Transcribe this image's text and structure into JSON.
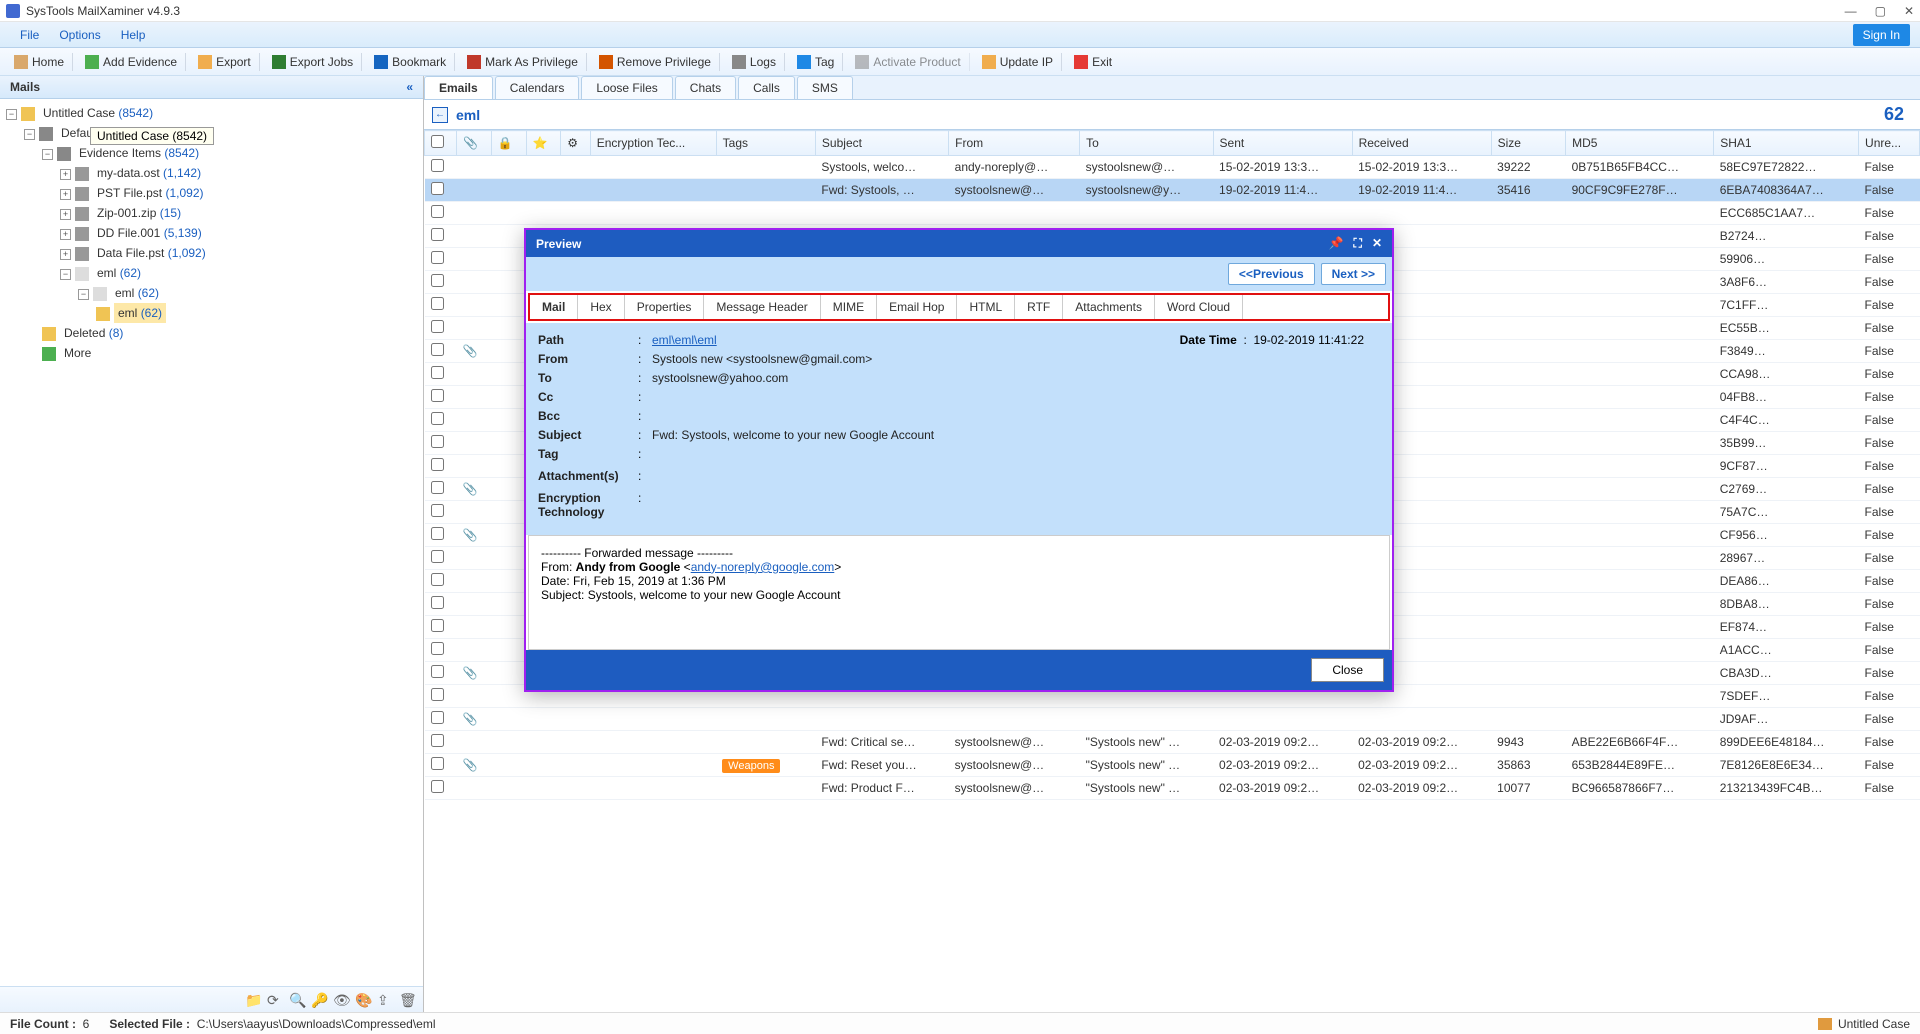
{
  "app": {
    "title": "SysTools MailXaminer v4.9.3"
  },
  "window_buttons": {
    "min": "—",
    "max": "▢",
    "close": "✕"
  },
  "menu": {
    "file": "File",
    "options": "Options",
    "help": "Help",
    "signin": "Sign In"
  },
  "toolbar": {
    "home": "Home",
    "add_evidence": "Add Evidence",
    "export": "Export",
    "export_jobs": "Export Jobs",
    "bookmark": "Bookmark",
    "mark_priv": "Mark As Privilege",
    "remove_priv": "Remove Privilege",
    "logs": "Logs",
    "tag": "Tag",
    "activate": "Activate Product",
    "update_ip": "Update IP",
    "exit": "Exit"
  },
  "mails_panel": {
    "title": "Mails",
    "tooltip": "Untitled Case (8542)",
    "tree": {
      "root": {
        "label": "Untitled Case",
        "count": "(8542)"
      },
      "default": {
        "label": "Default",
        "count": "(8542)"
      },
      "evidence": {
        "label": "Evidence Items",
        "count": "(8542)"
      },
      "items": [
        {
          "label": "my-data.ost",
          "count": "(1,142)"
        },
        {
          "label": "PST File.pst",
          "count": "(1,092)"
        },
        {
          "label": "Zip-001.zip",
          "count": "(15)"
        },
        {
          "label": "DD File.001",
          "count": "(5,139)"
        },
        {
          "label": "Data File.pst",
          "count": "(1,092)"
        },
        {
          "label": "eml",
          "count": "(62)"
        }
      ],
      "eml_sub1": {
        "label": "eml",
        "count": "(62)"
      },
      "eml_sub2": {
        "label": "eml",
        "count": "(62)"
      },
      "deleted": {
        "label": "Deleted",
        "count": "(8)"
      },
      "more": {
        "label": "More"
      }
    }
  },
  "tabs": {
    "emails": "Emails",
    "calendars": "Calendars",
    "loose": "Loose Files",
    "chats": "Chats",
    "calls": "Calls",
    "sms": "SMS"
  },
  "breadcrumb": {
    "path": "eml",
    "count": "62"
  },
  "columns": {
    "enc": "Encryption Tec...",
    "tags": "Tags",
    "subject": "Subject",
    "from": "From",
    "to": "To",
    "sent": "Sent",
    "received": "Received",
    "size": "Size",
    "md5": "MD5",
    "sha1": "SHA1",
    "unre": "Unre..."
  },
  "rows": [
    {
      "tags": "",
      "subject": "Systools, welco…",
      "from": "andy-noreply@…",
      "to": "systoolsnew@…",
      "sent": "15-02-2019 13:3…",
      "recv": "15-02-2019 13:3…",
      "size": "39222",
      "md5": "0B751B65FB4CC…",
      "sha1": "58EC97E72822…",
      "unre": "False",
      "sel": false,
      "attach": false
    },
    {
      "tags": "",
      "subject": "Fwd: Systools, …",
      "from": "systoolsnew@…",
      "to": "systoolsnew@y…",
      "sent": "19-02-2019 11:4…",
      "recv": "19-02-2019 11:4…",
      "size": "35416",
      "md5": "90CF9C9FE278F…",
      "sha1": "6EBA7408364A7…",
      "unre": "False",
      "sel": true,
      "attach": false
    },
    {
      "sha1": "ECC685C1AA7…",
      "unre": "False"
    },
    {
      "sha1": "B2724…",
      "unre": "False"
    },
    {
      "sha1": "59906…",
      "unre": "False"
    },
    {
      "sha1": "3A8F6…",
      "unre": "False"
    },
    {
      "sha1": "7C1FF…",
      "unre": "False"
    },
    {
      "sha1": "EC55B…",
      "unre": "False"
    },
    {
      "sha1": "F3849…",
      "unre": "False",
      "attach": true
    },
    {
      "sha1": "CCA98…",
      "unre": "False"
    },
    {
      "sha1": "04FB8…",
      "unre": "False"
    },
    {
      "sha1": "C4F4C…",
      "unre": "False"
    },
    {
      "sha1": "35B99…",
      "unre": "False"
    },
    {
      "sha1": "9CF87…",
      "unre": "False"
    },
    {
      "sha1": "C2769…",
      "unre": "False",
      "attach": true
    },
    {
      "sha1": "75A7C…",
      "unre": "False"
    },
    {
      "sha1": "CF956…",
      "unre": "False",
      "attach": true
    },
    {
      "sha1": "28967…",
      "unre": "False"
    },
    {
      "sha1": "DEA86…",
      "unre": "False"
    },
    {
      "sha1": "8DBA8…",
      "unre": "False"
    },
    {
      "sha1": "EF874…",
      "unre": "False"
    },
    {
      "sha1": "A1ACC…",
      "unre": "False"
    },
    {
      "sha1": "CBA3D…",
      "unre": "False",
      "attach": true
    },
    {
      "sha1": "7SDEF…",
      "unre": "False"
    },
    {
      "sha1": "JD9AF…",
      "unre": "False",
      "attach": true
    },
    {
      "tags": "",
      "subject": "Fwd: Critical se…",
      "from": "systoolsnew@…",
      "to": "\"Systools new\" …",
      "sent": "02-03-2019 09:2…",
      "recv": "02-03-2019 09:2…",
      "size": "9943",
      "md5": "ABE22E6B66F4F…",
      "sha1": "899DEE6E48184…",
      "unre": "False"
    },
    {
      "tags": "Weapons",
      "subject": "Fwd: Reset you…",
      "from": "systoolsnew@…",
      "to": "\"Systools new\" …",
      "sent": "02-03-2019 09:2…",
      "recv": "02-03-2019 09:2…",
      "size": "35863",
      "md5": "653B2844E89FE…",
      "sha1": "7E8126E8E6E34…",
      "unre": "False",
      "attach": true
    },
    {
      "tags": "",
      "subject": "Fwd: Product F…",
      "from": "systoolsnew@…",
      "to": "\"Systools new\" …",
      "sent": "02-03-2019 09:2…",
      "recv": "02-03-2019 09:2…",
      "size": "10077",
      "md5": "BC966587866F7…",
      "sha1": "213213439FC4B…",
      "unre": "False"
    }
  ],
  "preview": {
    "title": "Preview",
    "prev": "<<Previous",
    "next": "Next >>",
    "tabs": {
      "mail": "Mail",
      "hex": "Hex",
      "props": "Properties",
      "msghdr": "Message Header",
      "mime": "MIME",
      "ehop": "Email Hop",
      "html": "HTML",
      "rtf": "RTF",
      "att": "Attachments",
      "wc": "Word Cloud"
    },
    "labels": {
      "path": "Path",
      "from": "From",
      "to": "To",
      "cc": "Cc",
      "bcc": "Bcc",
      "subject": "Subject",
      "tag": "Tag",
      "attach": "Attachment(s)",
      "enc": "Encryption Technology",
      "datetime": "Date Time"
    },
    "values": {
      "path": "eml\\eml\\eml",
      "from": "Systools new <systoolsnew@gmail.com>",
      "to": "systoolsnew@yahoo.com",
      "cc": "",
      "bcc": "",
      "subject": "Fwd: Systools, welcome to your new Google Account",
      "tag": "",
      "datetime": "19-02-2019 11:41:22"
    },
    "body": {
      "l1": "---------- Forwarded message ---------",
      "l2a": "From: ",
      "l2b": "Andy from Google",
      "l2c": " <",
      "l2link": "andy-noreply@google.com",
      "l2d": ">",
      "l3": "Date: Fri, Feb 15, 2019 at 1:36 PM",
      "l4": "Subject: Systools, welcome to your new Google Account"
    },
    "close": "Close"
  },
  "status": {
    "file_count_lbl": "File Count :",
    "file_count": "6",
    "sel_file_lbl": "Selected File :",
    "sel_file": "C:\\Users\\aayus\\Downloads\\Compressed\\eml",
    "case": "Untitled Case"
  }
}
